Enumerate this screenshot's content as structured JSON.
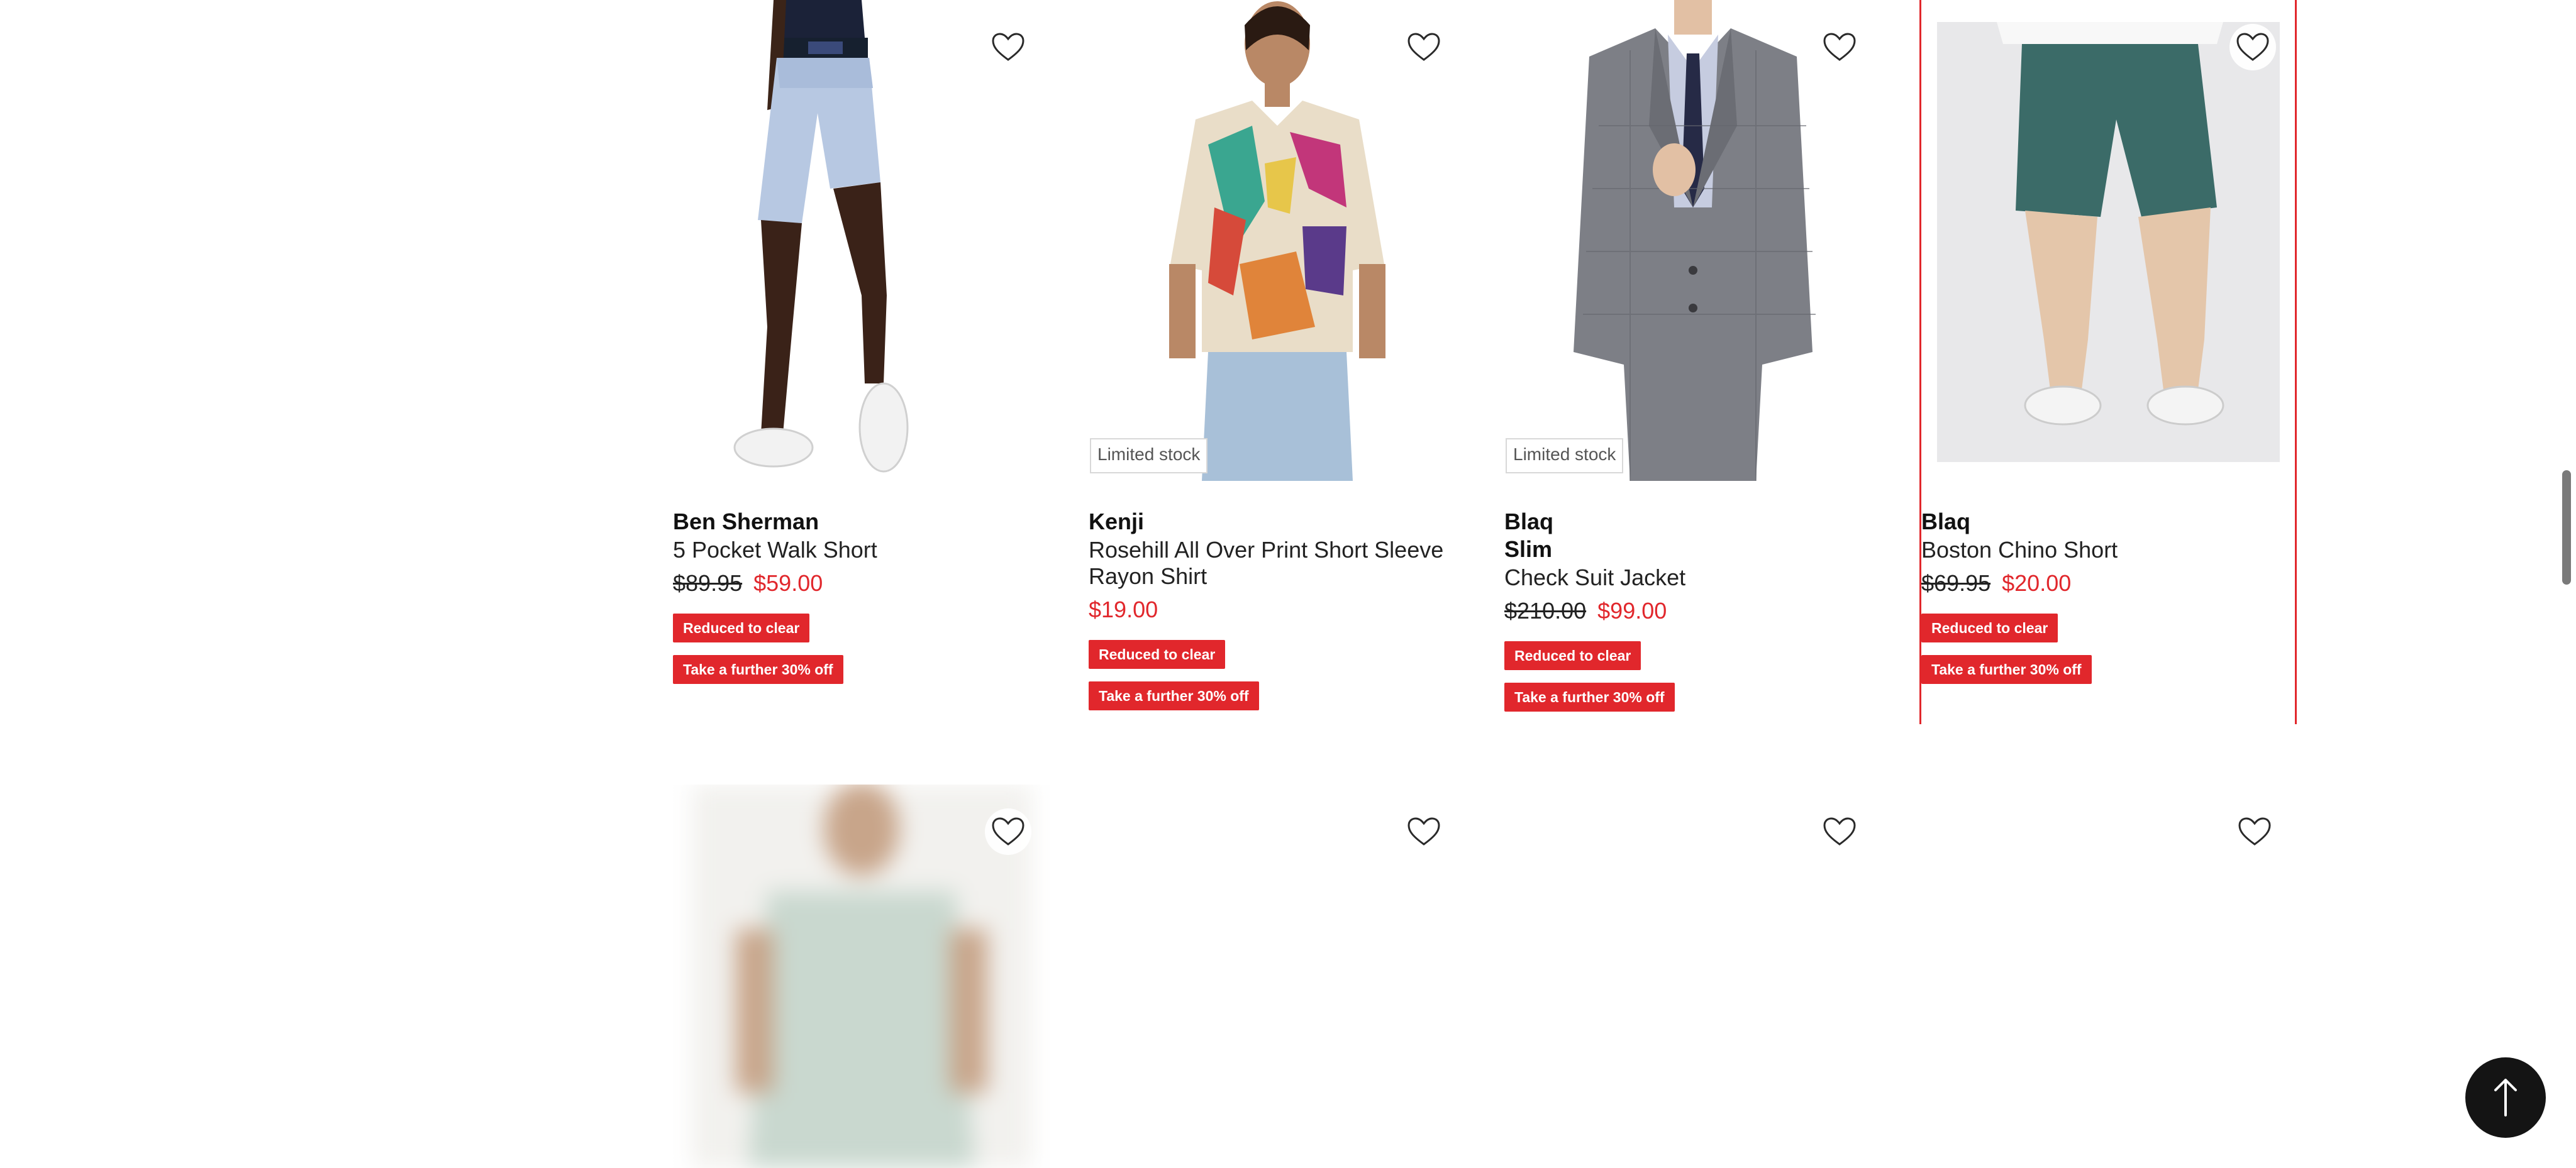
{
  "products_row1": [
    {
      "brand": "Ben Sherman",
      "subbrand": "",
      "name": "5 Pocket Walk Short",
      "was_price": "$89.95",
      "now_price": "$59.00",
      "limited_stock": "",
      "badges": [
        "Reduced to clear",
        "Take a further 30% off"
      ],
      "image": "light-blue-shorts"
    },
    {
      "brand": "Kenji",
      "subbrand": "",
      "name": "Rosehill All Over Print Short Sleeve Rayon Shirt",
      "was_price": "",
      "now_price": "$19.00",
      "limited_stock": "Limited stock",
      "badges": [
        "Reduced to clear",
        "Take a further 30% off"
      ],
      "image": "print-shirt"
    },
    {
      "brand": "Blaq",
      "subbrand": "Slim",
      "name": "Check Suit Jacket",
      "was_price": "$210.00",
      "now_price": "$99.00",
      "limited_stock": "Limited stock",
      "badges": [
        "Reduced to clear",
        "Take a further 30% off"
      ],
      "image": "grey-suit"
    },
    {
      "brand": "Blaq",
      "subbrand": "",
      "name": "Boston Chino Short",
      "was_price": "$69.95",
      "now_price": "$20.00",
      "limited_stock": "",
      "badges": [
        "Reduced to clear",
        "Take a further 30% off"
      ],
      "image": "teal-shorts"
    }
  ],
  "icons": {
    "favourite": "heart-outline-icon",
    "back_to_top": "arrow-up-icon"
  },
  "colors": {
    "accent_red": "#e1272c",
    "back_to_top_bg": "#141414"
  }
}
